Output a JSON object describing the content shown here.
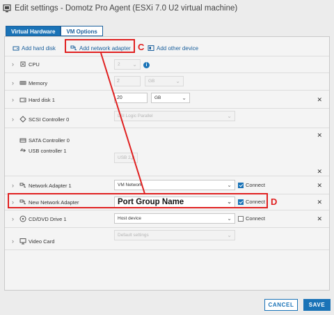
{
  "window": {
    "title": "Edit settings - Domotz Pro Agent (ESXi 7.0 U2 virtual machine)"
  },
  "tabs": [
    {
      "label": "Virtual Hardware",
      "active": true
    },
    {
      "label": "VM Options",
      "active": false
    }
  ],
  "toolbar": {
    "add_hard_disk": "Add hard disk",
    "add_network_adapter": "Add network adapter",
    "add_other_device": "Add other device"
  },
  "rows": {
    "cpu": {
      "label": "CPU",
      "value": "2"
    },
    "memory": {
      "label": "Memory",
      "value": "2",
      "unit": "GB"
    },
    "hard_disk": {
      "label": "Hard disk 1",
      "value": "20",
      "unit": "GB"
    },
    "scsi": {
      "label": "SCSI Controller 0",
      "value": "LSI Logic Parallel"
    },
    "sata": {
      "label": "SATA Controller 0"
    },
    "usb": {
      "label": "USB controller 1",
      "value": "USB 2.0"
    },
    "net1": {
      "label": "Network Adapter 1",
      "value": "VM Network",
      "connect": "Connect"
    },
    "newnet": {
      "label": "New Network Adapter",
      "value": "Port Group Name",
      "connect": "Connect"
    },
    "cd": {
      "label": "CD/DVD Drive 1",
      "value": "Host device",
      "connect": "Connect"
    },
    "video": {
      "label": "Video Card",
      "value": "Default settings"
    }
  },
  "annotations": {
    "c": "C",
    "d": "D"
  },
  "buttons": {
    "cancel": "CANCEL",
    "save": "SAVE"
  },
  "colors": {
    "accent": "#1a73b7",
    "annotation": "#e02020"
  }
}
